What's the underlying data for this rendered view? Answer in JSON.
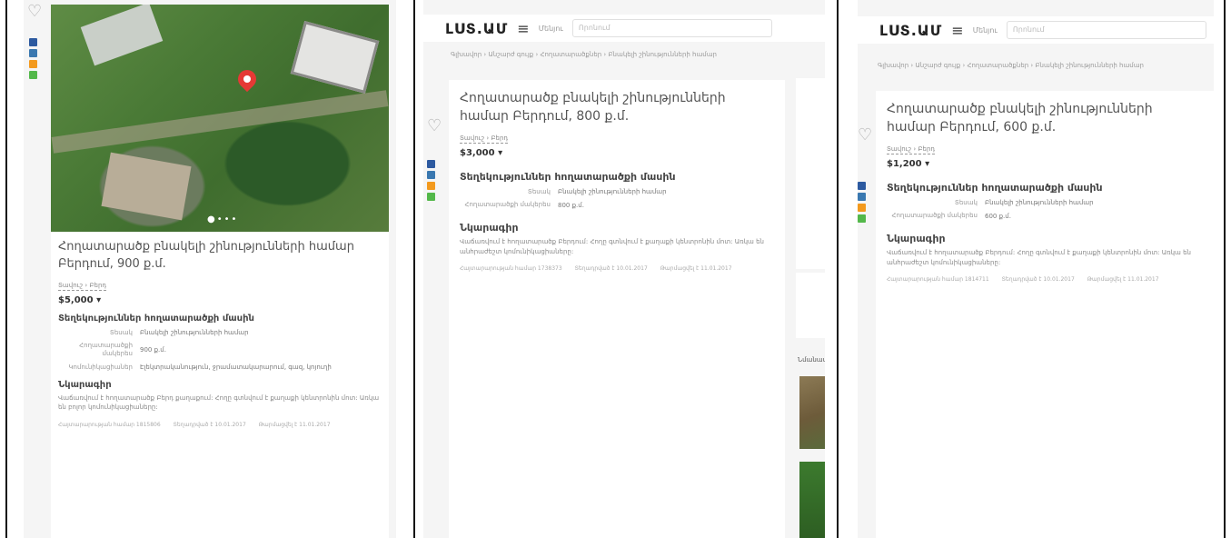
{
  "panels": [
    {
      "has_header": false,
      "title": "Հողատարածք բնակելի շինությունների համար Բերդում, 900 ք.մ.",
      "location": "Տավուշ › Բերդ",
      "price": "$5,000",
      "section_specs": "Տեղեկություններ հողատարածքի մասին",
      "specs": [
        {
          "key": "Տեսակ",
          "value": "Բնակելի շինությունների համար"
        },
        {
          "key": "Հողատարածքի մակերես",
          "value": "900 ք.մ."
        },
        {
          "key": "Կոմունիկացիաներ",
          "value": "Էլեկտրականություն, ջրամատակարարում, գազ, կոյուղի"
        }
      ],
      "section_desc": "Նկարագիր",
      "description": "Վաճառվում է հողատարածք Բերդ քաղաքում: Հողը գտնվում է քաղաքի կենտրոնին մոտ: Առկա են բոլոր կոմունիկացիաները:",
      "meta": [
        "Հայտարարության համար 1815806",
        "Տեղադրված է 10.01.2017",
        "Թարմացվել է 11.01.2017"
      ]
    },
    {
      "has_header": true,
      "logo": "ԼՍՏ.ԱՄ",
      "menu_label": "Մենյու",
      "search_placeholder": "Որոնում",
      "breadcrumb": "Գլխավոր › Անշարժ գույք › Հողատարածքներ › Բնակելի շինությունների համար",
      "title": "Հողատարածք բնակելի շինությունների համար Բերդում, 800 ք.մ.",
      "location": "Տավուշ › Բերդ",
      "price": "$3,000",
      "section_specs": "Տեղեկություններ հողատարածքի մասին",
      "specs": [
        {
          "key": "Տեսակ",
          "value": "Բնակելի շինությունների համար"
        },
        {
          "key": "Հողատարածքի մակերես",
          "value": "800 ք.մ."
        }
      ],
      "section_desc": "Նկարագիր",
      "description": "Վաճառվում է հողատարածք Բերդում: Հողը գտնվում է քաղաքի կենտրոնին մոտ: Առկա են անհրաժեշտ կոմունիկացիաները:",
      "meta": [
        "Հայտարարության համար 1738373",
        "Տեղադրված է 10.01.2017",
        "Թարմացվել է 11.01.2017"
      ],
      "side_label": "Նմանատիպ"
    },
    {
      "has_header": true,
      "logo": "ԼՍՏ.ԱՄ",
      "menu_label": "Մենյու",
      "search_placeholder": "Որոնում",
      "breadcrumb": "Գլխավոր › Անշարժ գույք › Հողատարածքներ › Բնակելի շինությունների համար",
      "title": "Հողատարածք բնակելի շինությունների համար Բերդում, 600 ք.մ.",
      "location": "Տավուշ › Բերդ",
      "price": "$1,200",
      "section_specs": "Տեղեկություններ հողատարածքի մասին",
      "specs": [
        {
          "key": "Տեսակ",
          "value": "Բնակելի շինությունների համար"
        },
        {
          "key": "Հողատարածքի մակերես",
          "value": "600 ք.մ."
        }
      ],
      "section_desc": "Նկարագիր",
      "description": "Վաճառվում է հողատարածք Բերդում: Հողը գտնվում է քաղաքի կենտրոնին մոտ: Առկա են անհրաժեշտ կոմունիկացիաները:",
      "meta": [
        "Հայտարարության համար 1814711",
        "Տեղադրված է 10.01.2017",
        "Թարմացվել է 11.01.2017"
      ]
    }
  ],
  "icons": {
    "favorite": "heart-icon",
    "share": [
      "facebook-icon",
      "vk-icon",
      "odnoklassniki-icon",
      "whatsapp-icon"
    ],
    "map_pin": "map-pin-icon",
    "price_dropdown": "chevron-down-icon"
  },
  "colors": {
    "pin": "#e53935",
    "facebook": "#2d5aa0",
    "vk": "#3a78b0",
    "ok": "#f39a1e",
    "whatsapp": "#53b84a"
  }
}
